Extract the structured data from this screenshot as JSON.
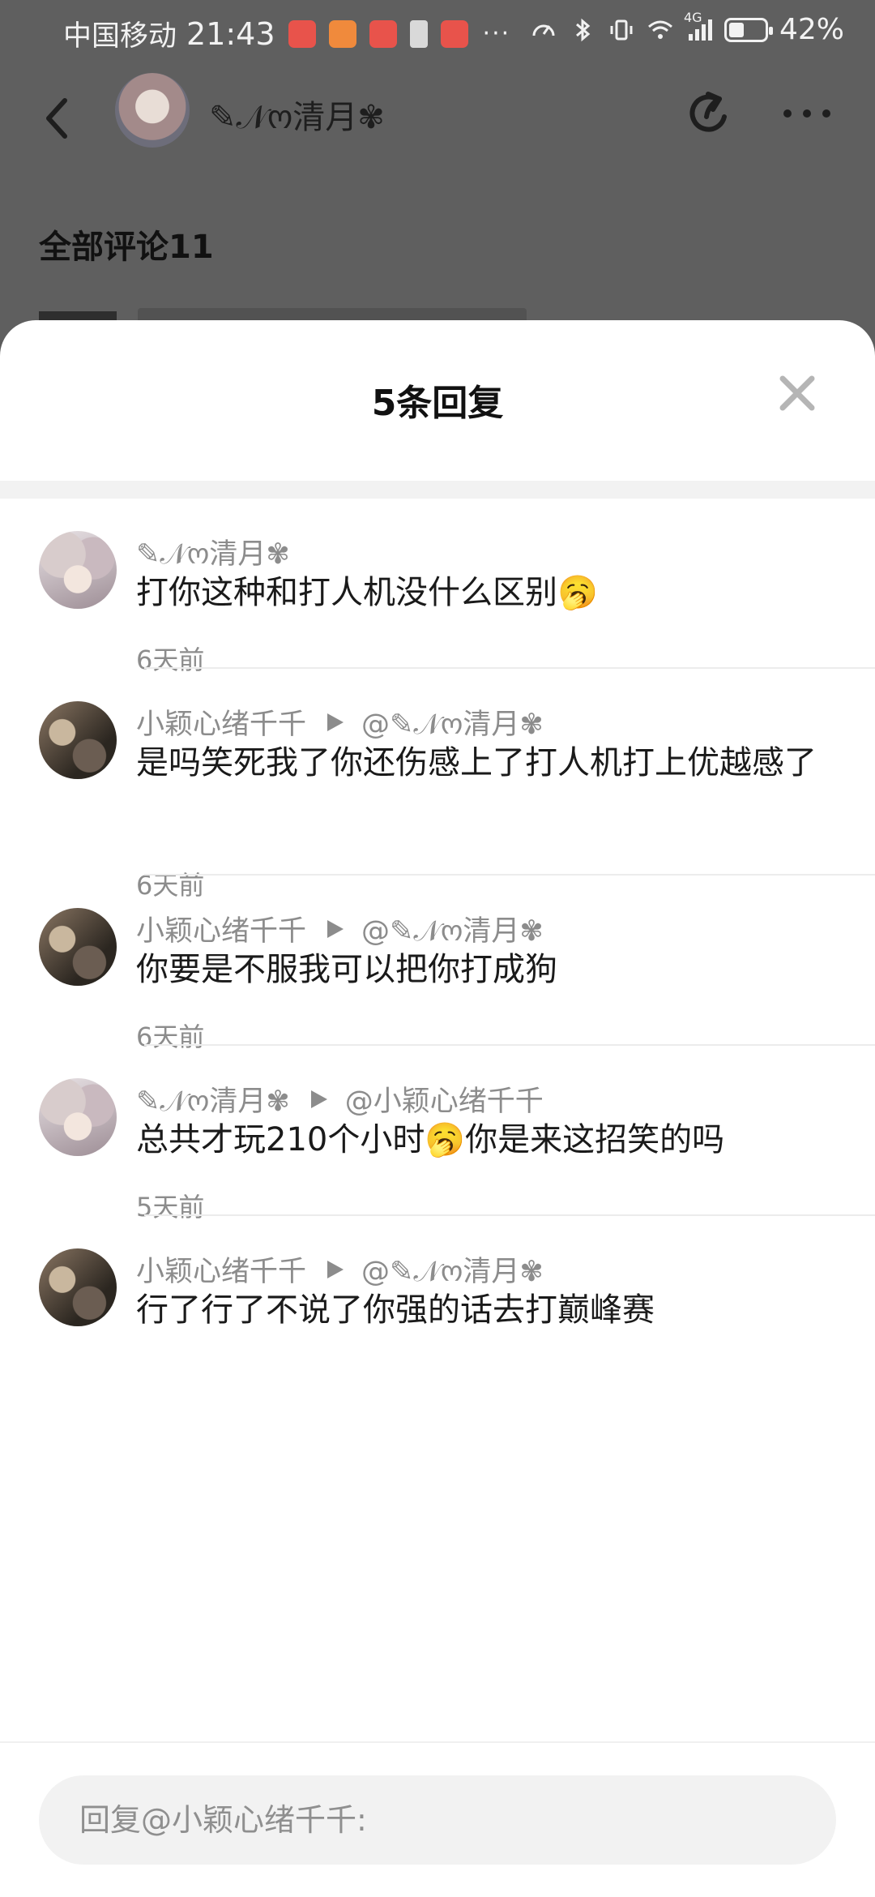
{
  "status_bar": {
    "carrier": "中国移动",
    "time": "21:43",
    "more": "···",
    "network": "4G",
    "battery_percent": "42%",
    "battery_level": 0.42
  },
  "header": {
    "username": "✎𝒩ო清月✾"
  },
  "comments_header": "全部评论11",
  "sheet": {
    "title": "5条回复",
    "close_icon": "close-icon"
  },
  "replies": [
    {
      "avatar": "anime",
      "author": "✎𝒩ო清月✾",
      "target": "",
      "text": "打你这种和打人机没什么区别🥱",
      "time": "6天前"
    },
    {
      "avatar": "photo",
      "author": "小颖心绪千千",
      "target": "@✎𝒩ო清月✾",
      "text": "是吗笑死我了你还伤感上了打人机打上优越感了",
      "time": "6天前"
    },
    {
      "avatar": "photo",
      "author": "小颖心绪千千",
      "target": "@✎𝒩ო清月✾",
      "text": "你要是不服我可以把你打成狗",
      "time": "6天前"
    },
    {
      "avatar": "anime",
      "author": "✎𝒩ო清月✾",
      "target": "@小颖心绪千千",
      "text": "总共才玩210个小时🥱你是来这招笑的吗",
      "time": "5天前"
    },
    {
      "avatar": "photo",
      "author": "小颖心绪千千",
      "target": "@✎𝒩ო清月✾",
      "text": "行了行了不说了你强的话去打巅峰赛",
      "time": ""
    }
  ],
  "input": {
    "placeholder": "回复@小颖心绪千千:"
  }
}
